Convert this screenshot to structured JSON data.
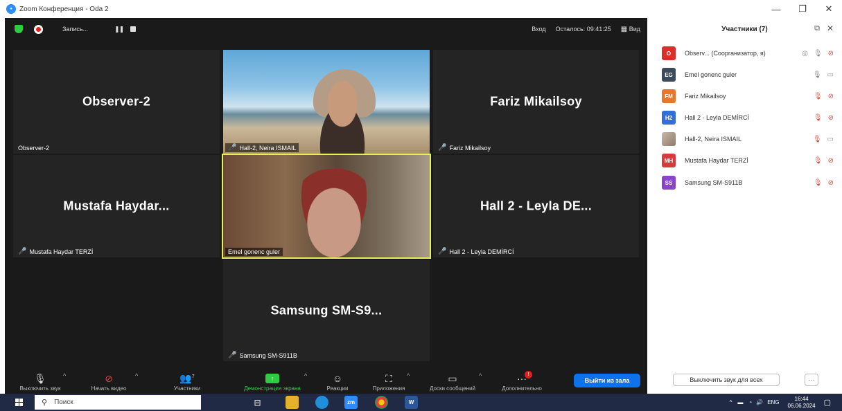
{
  "window": {
    "title": "Zoom Конференция - Oda 2",
    "minimize": "—",
    "restore": "❐",
    "close": "✕"
  },
  "topbar": {
    "record_label": "Запись...",
    "pause": "❚❚",
    "enter": "Вход",
    "remaining": "Осталось: 09:41:25",
    "view": "Вид"
  },
  "tiles": [
    {
      "big": "Observer-2",
      "tag": "Observer-2",
      "muted": false
    },
    {
      "big": "",
      "tag": "Hall-2, Neira ISMAIL",
      "muted": true
    },
    {
      "big": "Fariz Mikailsoy",
      "tag": "Fariz Mikailsoy",
      "muted": true
    },
    {
      "big": "Mustafa Haydar...",
      "tag": "Mustafa Haydar TERZİ",
      "muted": true
    },
    {
      "big": "",
      "tag": "Emel gonenc guler",
      "muted": false
    },
    {
      "big": "Hall 2 - Leyla DE...",
      "tag": "Hall 2 - Leyla DEMİRCİ",
      "muted": true
    },
    {
      "big": "Samsung SM-S9...",
      "tag": "Samsung SM-S911B",
      "muted": true
    }
  ],
  "toolbar": {
    "mute": "Выключить звук",
    "video": "Начать видео",
    "participants": "Участники",
    "participants_count": "7",
    "share": "Демонстрация экрана",
    "reactions": "Реакции",
    "apps": "Приложения",
    "whiteboards": "Доски сообщений",
    "more": "Дополнительно",
    "more_badge": "!",
    "leave": "Выйти из зала"
  },
  "panel": {
    "title": "Участники (7)",
    "participants": [
      {
        "initials": "O",
        "color": "#d9302c",
        "name": "Observ...  (Соорганизатор, я)"
      },
      {
        "initials": "EG",
        "color": "#3c4a5c",
        "name": "Emel gonenc guler"
      },
      {
        "initials": "FM",
        "color": "#e8762b",
        "name": "Fariz Mikailsoy"
      },
      {
        "initials": "H2",
        "color": "#2f6fd6",
        "name": "Hall 2 - Leyla DEMİRCİ"
      },
      {
        "initials": "",
        "color": "#8e7a6a",
        "name": "Hall-2, Neira ISMAIL"
      },
      {
        "initials": "MH",
        "color": "#d63c3c",
        "name": "Mustafa Haydar TERZİ"
      },
      {
        "initials": "SS",
        "color": "#8a44c8",
        "name": "Samsung SM-S911B"
      }
    ],
    "mute_all": "Выключить звук для всех",
    "more": "···"
  },
  "taskbar": {
    "search_placeholder": "Поиск",
    "zoom_app": "zm",
    "word_app": "W",
    "lang": "ENG",
    "time": "16:44",
    "date": "06.06.2024"
  }
}
